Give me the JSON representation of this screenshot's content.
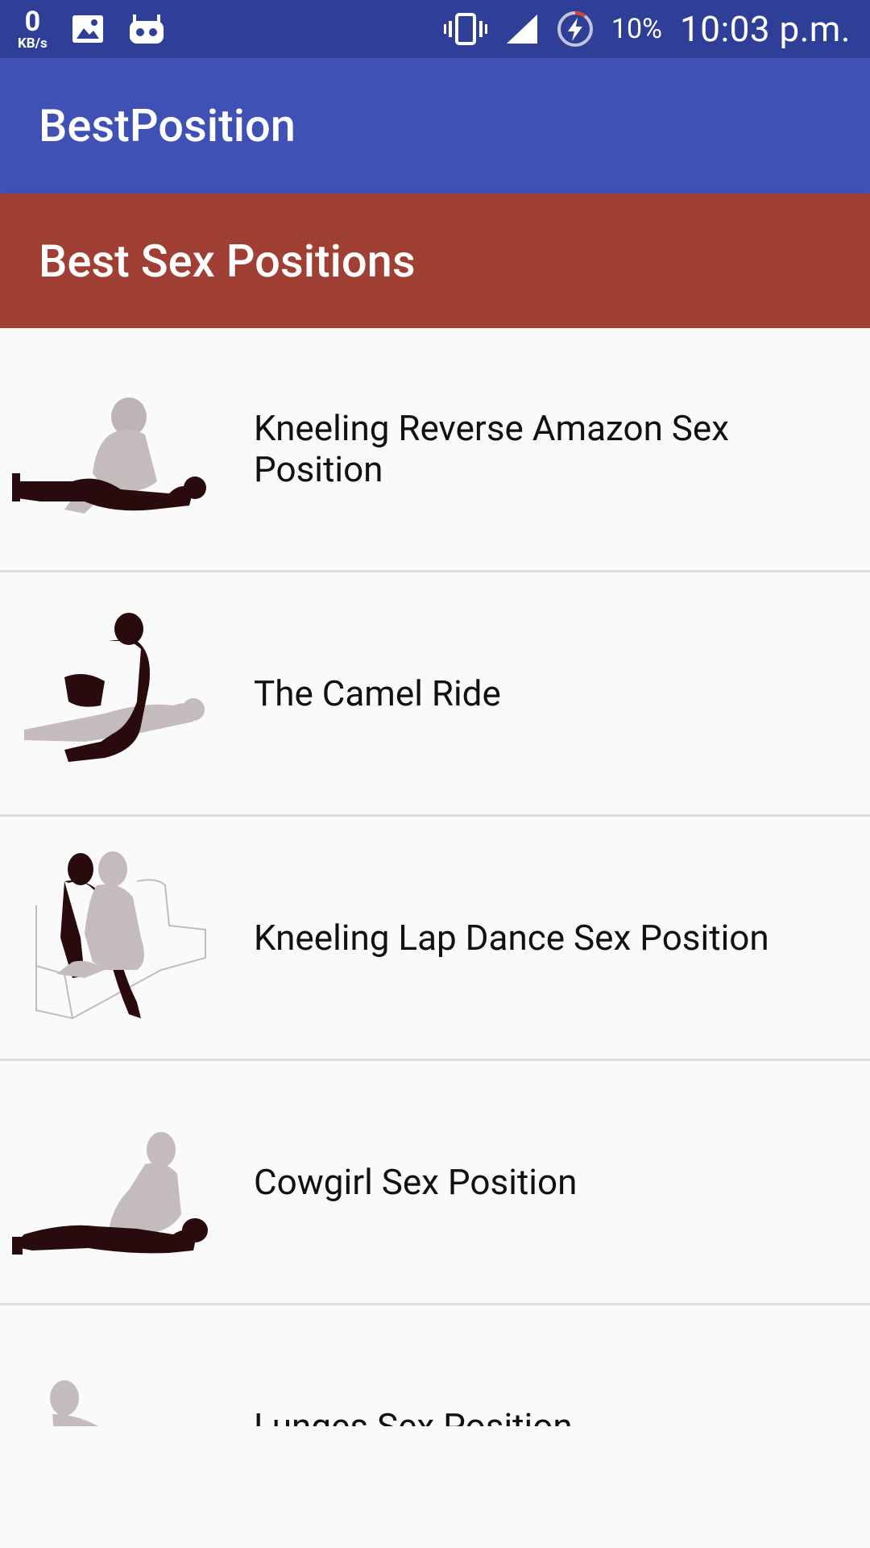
{
  "status_bar": {
    "net_speed_value": "0",
    "net_speed_unit": "KB/s",
    "battery_percent": "10%",
    "time": "10:03 p.m."
  },
  "app_bar": {
    "title": "BestPosition"
  },
  "section": {
    "title": "Best Sex Positions"
  },
  "positions": [
    {
      "label": "Kneeling Reverse Amazon Sex Position"
    },
    {
      "label": "The Camel Ride"
    },
    {
      "label": "Kneeling Lap Dance Sex Position"
    },
    {
      "label": "Cowgirl Sex Position"
    },
    {
      "label": "Lunges Sex Position"
    }
  ],
  "colors": {
    "status_bar": "#2f3f98",
    "app_bar": "#3f51b5",
    "section_header": "#a03f33",
    "list_background": "#fafafa"
  }
}
